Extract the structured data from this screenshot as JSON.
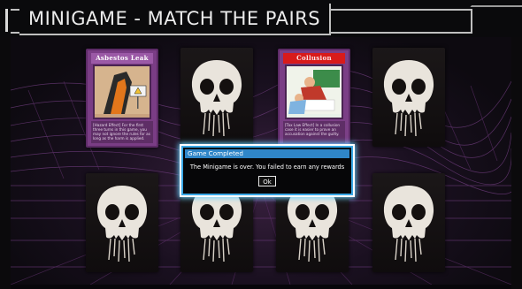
{
  "header": {
    "title": "MINIGAME - MATCH THE PAIRS"
  },
  "cards": [
    {
      "state": "face",
      "title": "Asbestos Leak",
      "style": "purple",
      "text": "[Hazard Effect] For the first three turns in this game, you may not ignore the rules for as long as the harm is applied.",
      "art_icon": "asbestos-hazard-icon"
    },
    {
      "state": "back"
    },
    {
      "state": "face",
      "title": "Collusion",
      "style": "red",
      "text": "[Tax Law Effect] In a collusion case it is easier to prove an accusation against the guilty.",
      "art_icon": "collusion-scene-icon"
    },
    {
      "state": "back"
    },
    {
      "state": "back"
    },
    {
      "state": "back"
    },
    {
      "state": "back"
    },
    {
      "state": "back"
    }
  ],
  "dialog": {
    "title": "Game Completed",
    "message": "The Minigame is over. You failed to earn any rewards",
    "ok_label": "Ok"
  },
  "colors": {
    "dialog_border": "#39a8e6",
    "title_bar": "#2f86c9",
    "card_purple": "#7a3d85",
    "card_red_title": "#d81b1b"
  }
}
